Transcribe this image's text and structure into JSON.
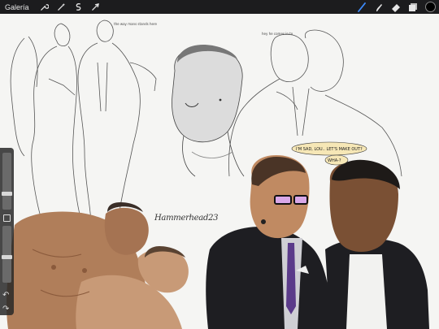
{
  "toolbar": {
    "gallery_label": "Galería",
    "left_icons": [
      "wrench-icon",
      "magic-wand-icon",
      "selection-icon",
      "transform-arrow-icon"
    ],
    "right_icons": [
      "brush-icon",
      "smudge-icon",
      "eraser-icon",
      "layers-icon"
    ],
    "active_tool": "brush",
    "active_color": "#000000"
  },
  "canvas": {
    "signature": "Hammerhead23",
    "speech_bubble_1": "I'M SAD, LOU.. LET'S MAKE OUT?",
    "speech_bubble_2": "WHA-?",
    "scribble_1": "the way mans stands here",
    "scribble_2": "hey he comes in to"
  },
  "sidebar": {
    "brush_size_level": 0.3,
    "opacity_level": 0.65,
    "undo_icon": "undo-icon",
    "redo_icon": "redo-icon"
  }
}
